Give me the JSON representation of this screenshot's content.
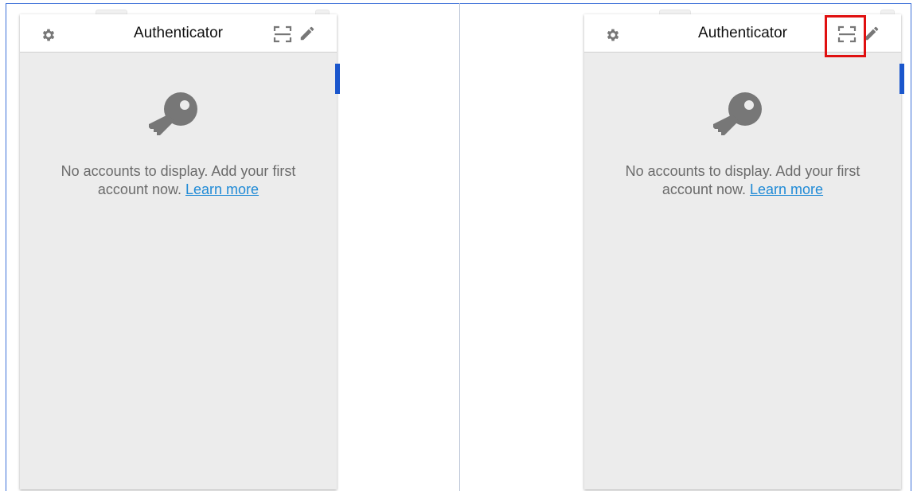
{
  "panels": [
    {
      "header": {
        "title": "Authenticator",
        "settings_icon": "gear-icon",
        "scan_icon": "scan-qr-icon",
        "edit_icon": "pencil-icon"
      },
      "empty_state": {
        "icon": "key-icon",
        "message": "No accounts to display. Add your first account now.",
        "link_label": "Learn more"
      }
    },
    {
      "header": {
        "title": "Authenticator",
        "settings_icon": "gear-icon",
        "scan_icon": "scan-qr-icon",
        "edit_icon": "pencil-icon"
      },
      "empty_state": {
        "icon": "key-icon",
        "message": "No accounts to display. Add your first account now.",
        "link_label": "Learn more"
      },
      "highlighted": "scan-qr-icon"
    }
  ],
  "colors": {
    "highlight": "#e01010",
    "link": "#1f8ad6",
    "scrollbar": "#1a56cc",
    "panel_bg": "#ececec",
    "icon": "#777777"
  }
}
